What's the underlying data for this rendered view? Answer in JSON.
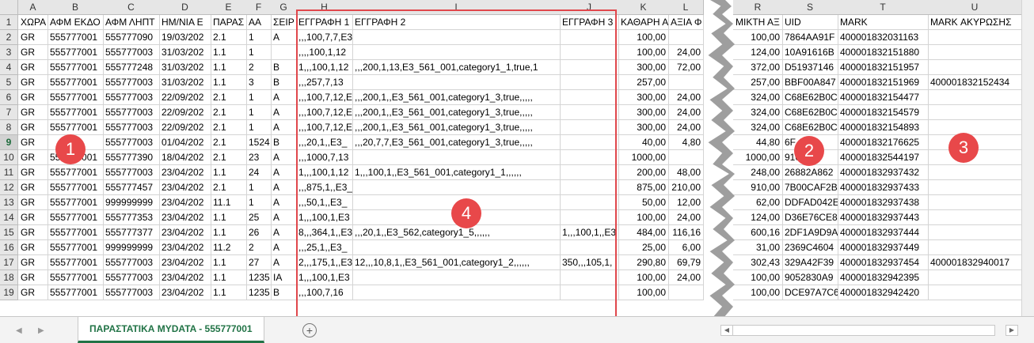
{
  "columns": [
    {
      "letter": "A",
      "header": "ΧΩΡΑ"
    },
    {
      "letter": "B",
      "header": "ΑΦΜ ΕΚΔΟ"
    },
    {
      "letter": "C",
      "header": "ΑΦΜ ΛΗΠΤ"
    },
    {
      "letter": "D",
      "header": "ΗΜ/ΝΙΑ Ε"
    },
    {
      "letter": "E",
      "header": "ΠΑΡΑΣ"
    },
    {
      "letter": "F",
      "header": "ΑΑ"
    },
    {
      "letter": "G",
      "header": "ΣΕΙΡ"
    },
    {
      "letter": "H",
      "header": "ΕΓΓΡΑΦΗ 1"
    },
    {
      "letter": "I",
      "header": "ΕΓΓΡΑΦΗ 2"
    },
    {
      "letter": "J",
      "header": "ΕΓΓΡΑΦΗ 3"
    },
    {
      "letter": "K",
      "header": "ΚΑΘΑΡΗ Α"
    },
    {
      "letter": "L",
      "header": "ΑΞΙΑ Φ"
    },
    {
      "letter": "R",
      "header": "ΜΙΚΤΗ ΑΞ"
    },
    {
      "letter": "S",
      "header": "UID"
    },
    {
      "letter": "T",
      "header": "MARK"
    },
    {
      "letter": "U",
      "header": "MARK ΑΚΥΡΩΣΗΣ"
    }
  ],
  "rows": [
    {
      "n": "2",
      "c": [
        "GR",
        "555777001",
        "555777090",
        "19/03/202",
        "2.1",
        "1",
        "A",
        ",,,100,7,7,E3",
        "",
        "",
        "100,00",
        "",
        "100,00",
        "7864AA91F",
        "400001832031163",
        ""
      ]
    },
    {
      "n": "3",
      "c": [
        "GR",
        "555777001",
        "555777003",
        "31/03/202",
        "1.1",
        "1",
        "",
        ",,,,100,1,12",
        "",
        "",
        "100,00",
        "24,00",
        "124,00",
        "10A91616B",
        "400001832151880",
        ""
      ]
    },
    {
      "n": "4",
      "c": [
        "GR",
        "555777001",
        "555777248",
        "31/03/202",
        "1.1",
        "2",
        "B",
        "1,,,100,1,12",
        ",,,200,1,13,E3_561_001,category1_1,true,1",
        "",
        "300,00",
        "72,00",
        "372,00",
        "D51937146",
        "400001832151957",
        ""
      ]
    },
    {
      "n": "5",
      "c": [
        "GR",
        "555777001",
        "555777003",
        "31/03/202",
        "1.1",
        "3",
        "B",
        ",,,257,7,13",
        "",
        "",
        "257,00",
        "",
        "257,00",
        "BBF00A847",
        "400001832151969",
        "400001832152434"
      ]
    },
    {
      "n": "6",
      "c": [
        "GR",
        "555777001",
        "555777003",
        "22/09/202",
        "2.1",
        "1",
        "A",
        ",,,100,7,12,E",
        ",,,200,1,,E3_561_001,category1_3,true,,,,,",
        "",
        "300,00",
        "24,00",
        "324,00",
        "C68E62B0C",
        "400001832154477",
        ""
      ]
    },
    {
      "n": "7",
      "c": [
        "GR",
        "555777001",
        "555777003",
        "22/09/202",
        "2.1",
        "1",
        "A",
        ",,,100,7,12,E",
        ",,,200,1,,E3_561_001,category1_3,true,,,,,",
        "",
        "300,00",
        "24,00",
        "324,00",
        "C68E62B0C",
        "400001832154579",
        ""
      ]
    },
    {
      "n": "8",
      "c": [
        "GR",
        "555777001",
        "555777003",
        "22/09/202",
        "2.1",
        "1",
        "A",
        ",,,100,7,12,E",
        ",,,200,1,,E3_561_001,category1_3,true,,,,,",
        "",
        "300,00",
        "24,00",
        "324,00",
        "C68E62B0C",
        "400001832154893",
        ""
      ]
    },
    {
      "n": "9",
      "c": [
        "GR",
        "",
        "555777003",
        "01/04/202",
        "2.1",
        "1524",
        "B",
        ",,,20,1,,E3_",
        ",,,20,7,7,E3_561_001,category1_3,true,,,,,",
        "",
        "40,00",
        "4,80",
        "44,80",
        "6F",
        "400001832176625",
        ""
      ]
    },
    {
      "n": "10",
      "c": [
        "GR",
        "555777001",
        "555777390",
        "18/04/202",
        "2.1",
        "23",
        "A",
        ",,,1000,7,13",
        "",
        "",
        "1000,00",
        "",
        "1000,00",
        "910",
        "400001832544197",
        ""
      ]
    },
    {
      "n": "11",
      "c": [
        "GR",
        "555777001",
        "555777003",
        "23/04/202",
        "1.1",
        "24",
        "A",
        "1,,,100,1,12",
        "1,,,100,1,,E3_561_001,category1_1,,,,,,",
        "",
        "200,00",
        "48,00",
        "248,00",
        "26882A862",
        "400001832937432",
        ""
      ]
    },
    {
      "n": "12",
      "c": [
        "GR",
        "555777001",
        "555777457",
        "23/04/202",
        "2.1",
        "1",
        "A",
        ",,,875,1,,E3_",
        "",
        "",
        "875,00",
        "210,00",
        "910,00",
        "7B00CAF2B",
        "400001832937433",
        ""
      ]
    },
    {
      "n": "13",
      "c": [
        "GR",
        "555777001",
        "999999999",
        "23/04/202",
        "11.1",
        "1",
        "A",
        ",,,50,1,,E3_",
        "",
        "",
        "50,00",
        "12,00",
        "62,00",
        "DDFAD042E",
        "400001832937438",
        ""
      ]
    },
    {
      "n": "14",
      "c": [
        "GR",
        "555777001",
        "555777353",
        "23/04/202",
        "1.1",
        "25",
        "A",
        "1,,,100,1,E3",
        "",
        "",
        "100,00",
        "24,00",
        "124,00",
        "D36E76CE8",
        "400001832937443",
        ""
      ]
    },
    {
      "n": "15",
      "c": [
        "GR",
        "555777001",
        "555777377",
        "23/04/202",
        "1.1",
        "26",
        "A",
        "8,,,364,1,,E3",
        ",,,20,1,,E3_562,category1_5,,,,,,",
        "1,,,100,1,,E3",
        "484,00",
        "116,16",
        "600,16",
        "2DF1A9D9A",
        "400001832937444",
        ""
      ]
    },
    {
      "n": "16",
      "c": [
        "GR",
        "555777001",
        "999999999",
        "23/04/202",
        "11.2",
        "2",
        "A",
        ",,,25,1,,E3_",
        "",
        "",
        "25,00",
        "6,00",
        "31,00",
        "2369C4604",
        "400001832937449",
        ""
      ]
    },
    {
      "n": "17",
      "c": [
        "GR",
        "555777001",
        "555777003",
        "23/04/202",
        "1.1",
        "27",
        "A",
        "2,,,175,1,,E3",
        "12,,,10,8,1,,E3_561_001,category1_2,,,,,,",
        "350,,,105,1,",
        "290,80",
        "69,79",
        "302,43",
        "329A42F39",
        "400001832937454",
        "400001832940017"
      ]
    },
    {
      "n": "18",
      "c": [
        "GR",
        "555777001",
        "555777003",
        "23/04/202",
        "1.1",
        "1235",
        "IA",
        "1,,,100,1,E3",
        "",
        "",
        "100,00",
        "24,00",
        "100,00",
        "9052830A9",
        "400001832942395",
        ""
      ]
    },
    {
      "n": "19",
      "c": [
        "GR",
        "555777001",
        "555777003",
        "23/04/202",
        "1.1",
        "1235",
        "B",
        ",,,100,7,16",
        "",
        "",
        "100,00",
        "",
        "100,00",
        "DCE97A7C6",
        "400001832942420",
        ""
      ]
    }
  ],
  "sheet_tab": "ΠΑΡΑΣΤΑΤΙΚΑ MYDATA - 555777001",
  "add_sheet_icon": "+",
  "badges": {
    "b1": "1",
    "b2": "2",
    "b3": "3",
    "b4": "4"
  },
  "colors": {
    "accent": "#217346",
    "badge": "#e8484a"
  }
}
